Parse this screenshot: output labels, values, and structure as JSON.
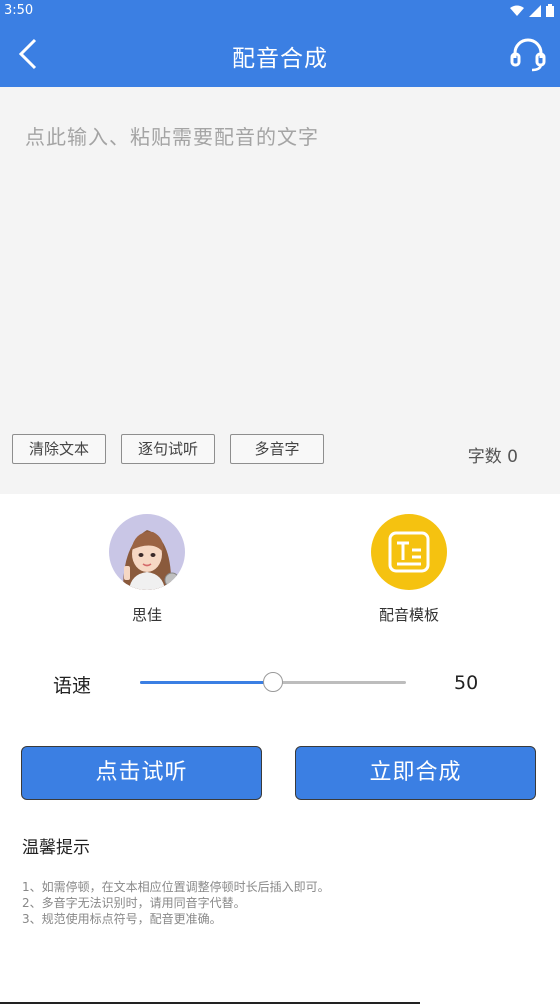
{
  "status_bar": {
    "time": "3:50"
  },
  "app_bar": {
    "title": "配音合成"
  },
  "editor": {
    "placeholder": "点此输入、粘贴需要配音的文字",
    "buttons": [
      "清除文本",
      "逐句试听",
      "多音字"
    ],
    "word_count": "字数 0"
  },
  "voice": {
    "name": "思佳"
  },
  "template": {
    "label": "配音模板"
  },
  "speed": {
    "label": "语速",
    "value": "50",
    "fraction": 0.5
  },
  "actions": {
    "preview": "点击试听",
    "synthesize": "立即合成"
  },
  "tips": {
    "title": "温馨提示",
    "items": [
      "1、如需停顿，在文本相应位置调整停顿时长后插入即可。",
      "2、多音字无法识别时，请用同音字代替。",
      "3、规范使用标点符号，配音更准确。"
    ]
  },
  "colors": {
    "primary": "#3b7fe3",
    "template_icon": "#f5c210"
  }
}
